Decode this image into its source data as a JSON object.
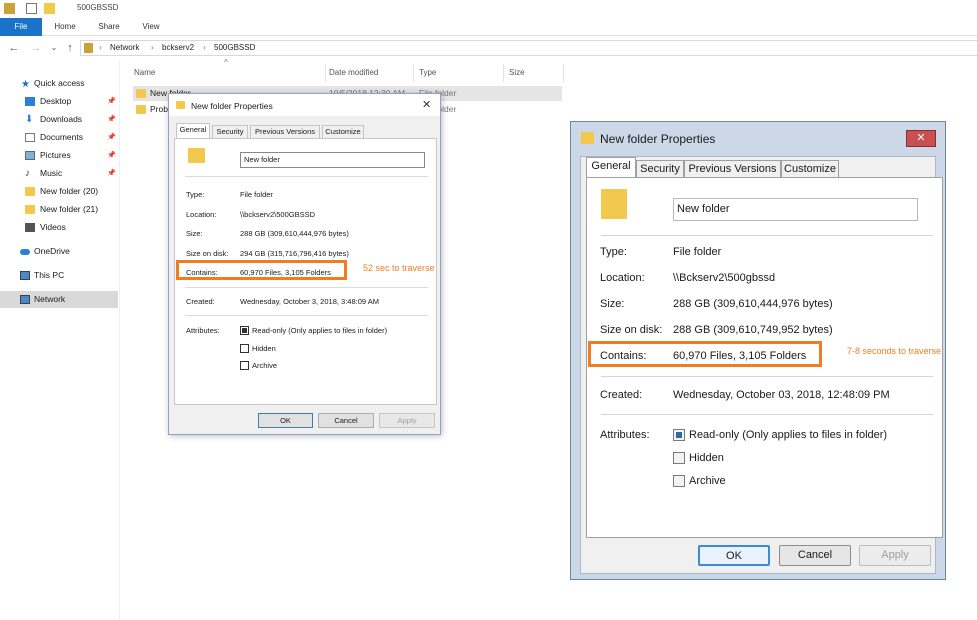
{
  "explorer": {
    "window_title": "500GBSSD",
    "ribbon_tabs": [
      "File",
      "Home",
      "Share",
      "View"
    ],
    "breadcrumb": [
      "Network",
      "bckserv2",
      "500GBSSD"
    ],
    "sidebar": [
      {
        "label": "Quick access",
        "icon": "star-icon"
      },
      {
        "label": "Desktop",
        "icon": "desktop-icon"
      },
      {
        "label": "Downloads",
        "icon": "download-icon"
      },
      {
        "label": "Documents",
        "icon": "documents-icon"
      },
      {
        "label": "Pictures",
        "icon": "pictures-icon"
      },
      {
        "label": "Music",
        "icon": "music-icon"
      },
      {
        "label": "New folder (20)",
        "icon": "folder-icon"
      },
      {
        "label": "New folder (21)",
        "icon": "folder-icon"
      },
      {
        "label": "Videos",
        "icon": "videos-icon"
      },
      {
        "label": "OneDrive",
        "icon": "cloud-icon"
      },
      {
        "label": "This PC",
        "icon": "computer-icon"
      },
      {
        "label": "Network",
        "icon": "network-icon"
      }
    ],
    "columns": [
      "Name",
      "Date modified",
      "Type",
      "Size"
    ],
    "rows": [
      {
        "name": "New folder",
        "date": "10/5/2018 12:30 AM",
        "type": "File folder"
      },
      {
        "name": "Prob",
        "date": "",
        "type": "File folder"
      }
    ]
  },
  "dialog_small": {
    "title": "New folder Properties",
    "tabs": [
      "General",
      "Security",
      "Previous Versions",
      "Customize"
    ],
    "folder_name": "New folder",
    "type_label": "Type:",
    "type_value": "File folder",
    "location_label": "Location:",
    "location_value": "\\\\bckserv2\\500GBSSD",
    "size_label": "Size:",
    "size_value": "288 GB (309,610,444,976 bytes)",
    "disk_label": "Size on disk:",
    "disk_value": "294 GB (315,716,796,416 bytes)",
    "contains_label": "Contains:",
    "contains_value": "60,970 Files, 3,105 Folders",
    "created_label": "Created:",
    "created_value": "Wednesday, October 3, 2018, 3:48:09 AM",
    "attributes_label": "Attributes:",
    "readonly_label": "Read-only (Only applies to files in folder)",
    "hidden_label": "Hidden",
    "archive_label": "Archive",
    "ok_label": "OK",
    "cancel_label": "Cancel",
    "apply_label": "Apply",
    "annotation": "52 sec to traverse"
  },
  "dialog_large": {
    "title": "New folder Properties",
    "tabs": [
      "General",
      "Security",
      "Previous Versions",
      "Customize"
    ],
    "folder_name": "New folder",
    "type_label": "Type:",
    "type_value": "File folder",
    "location_label": "Location:",
    "location_value": "\\\\Bckserv2\\500gbssd",
    "size_label": "Size:",
    "size_value": "288 GB (309,610,444,976 bytes)",
    "disk_label": "Size on disk:",
    "disk_value": "288 GB (309,610,749,952 bytes)",
    "contains_label": "Contains:",
    "contains_value": "60,970 Files, 3,105 Folders",
    "created_label": "Created:",
    "created_value": "Wednesday, October 03, 2018, 12:48:09 PM",
    "attributes_label": "Attributes:",
    "readonly_label": "Read-only (Only applies to files in folder)",
    "hidden_label": "Hidden",
    "archive_label": "Archive",
    "ok_label": "OK",
    "cancel_label": "Cancel",
    "apply_label": "Apply",
    "annotation": "7-8 seconds to traverse"
  },
  "colors": {
    "highlight": "#f07d21",
    "file_tab": "#1a73c9"
  }
}
